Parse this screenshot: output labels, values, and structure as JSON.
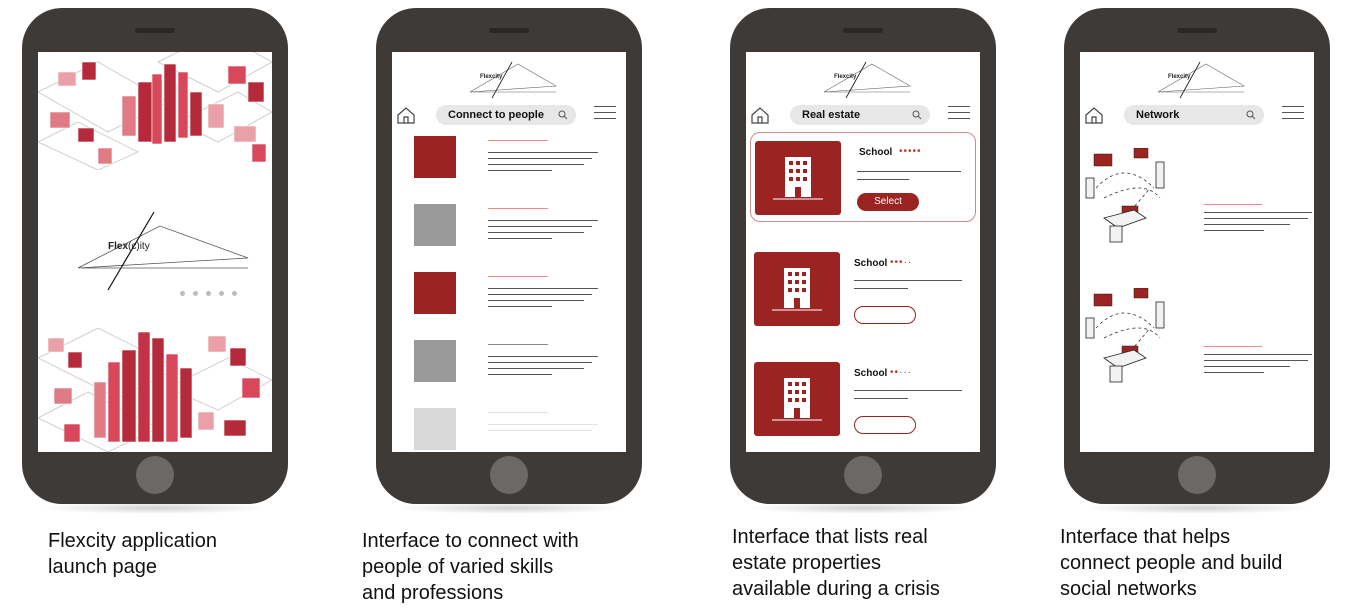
{
  "colors": {
    "phone_body": "#3d3a38",
    "accent_red": "#9b2423",
    "gray_block": "#999999",
    "light_gray_block": "#d8d8d8"
  },
  "phone1": {
    "logo_prefix": "Flex",
    "logo_mid": "(c)",
    "logo_suffix": "ity",
    "caption_line1": "Flexcity application",
    "caption_line2": "launch page"
  },
  "phone2": {
    "app_logo": "Flexcity",
    "search_placeholder": "Connect to people",
    "caption_line1": "Interface to connect with",
    "caption_line2": "people of varied skills",
    "caption_line3": "and professions"
  },
  "phone3": {
    "app_logo": "Flexcity",
    "search_placeholder": "Real estate",
    "properties": [
      {
        "name": "School",
        "rating": "•••••",
        "button": "Select"
      },
      {
        "name": "School",
        "rating": "•••··",
        "button": ""
      },
      {
        "name": "School",
        "rating": "••···",
        "button": ""
      }
    ],
    "caption_line1": "Interface that lists real",
    "caption_line2": "estate properties",
    "caption_line3": "available during a crisis"
  },
  "phone4": {
    "app_logo": "Flexcity",
    "search_placeholder": "Network",
    "caption_line1": "Interface that helps",
    "caption_line2": "connect people and build",
    "caption_line3": "social networks"
  }
}
